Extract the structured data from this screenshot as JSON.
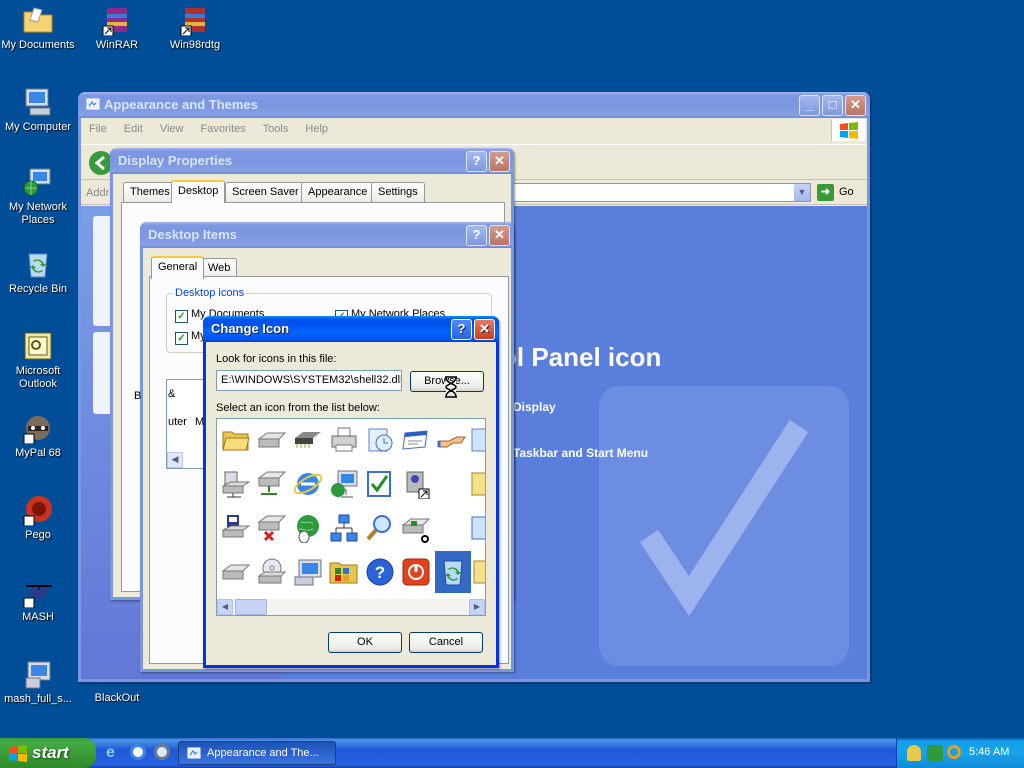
{
  "desktop_icons": [
    {
      "label": "My Documents"
    },
    {
      "label": "WinRAR"
    },
    {
      "label": "Win98rdtg"
    },
    {
      "label": "My Computer"
    },
    {
      "label": "My Network Places"
    },
    {
      "label": "Recycle Bin"
    },
    {
      "label": "Microsoft Outlook"
    },
    {
      "label": "MyPal 68"
    },
    {
      "label": "Pego"
    },
    {
      "label": "MASH"
    },
    {
      "label": "mash_full_s..."
    },
    {
      "label": "BlackOut"
    }
  ],
  "explorer": {
    "title": "Appearance and Themes",
    "menu": [
      "File",
      "Edit",
      "View",
      "Favorites",
      "Tools",
      "Help"
    ],
    "address_label": "Addre",
    "go_label": "Go",
    "heading": "ol Panel icon",
    "links": [
      "Display",
      "Taskbar and Start Menu"
    ]
  },
  "display_properties": {
    "title": "Display Properties",
    "tabs": [
      "Themes",
      "Desktop",
      "Screen Saver",
      "Appearance",
      "Settings"
    ],
    "selected_tab": "Desktop"
  },
  "desktop_items": {
    "title": "Desktop Items",
    "tabs": [
      "General",
      "Web"
    ],
    "group_label": "Desktop icons",
    "checkboxes": [
      {
        "label": "My Documents",
        "checked": true
      },
      {
        "label": "My Network Places",
        "checked": true
      },
      {
        "label": "My",
        "checked": true
      }
    ],
    "list_fragments": [
      "B",
      "&",
      "uter",
      "M"
    ]
  },
  "change_icon": {
    "title": "Change Icon",
    "file_label": "Look for icons in this file:",
    "file_value": "E:\\WINDOWS\\SYSTEM32\\shell32.dll",
    "browse_label": "Browse...",
    "list_label": "Select an icon from the list below:",
    "ok_label": "OK",
    "cancel_label": "Cancel"
  },
  "taskbar": {
    "start_label": "start",
    "task_label": "Appearance and The...",
    "clock": "5:46 AM"
  },
  "colors": {
    "desktop": "#004e98",
    "titlebar_active": "#0055ea",
    "window_face": "#ece9d8",
    "start_green": "#3c9a38"
  }
}
